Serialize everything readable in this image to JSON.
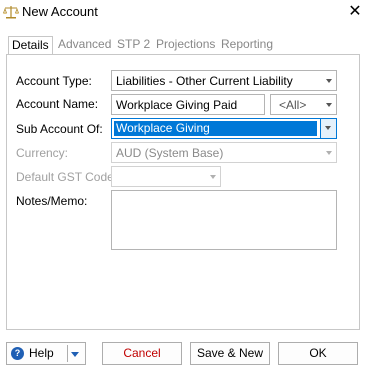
{
  "window": {
    "title": "New Account",
    "close_glyph": "✕",
    "icon": "scales-icon"
  },
  "tabs": [
    {
      "label": "Details",
      "active": true
    },
    {
      "label": "Advanced",
      "active": false
    },
    {
      "label": "STP 2",
      "active": false
    },
    {
      "label": "Projections",
      "active": false
    },
    {
      "label": "Reporting",
      "active": false
    }
  ],
  "form": {
    "account_type": {
      "label": "Account Type:",
      "value": "Liabilities - Other Current Liability"
    },
    "account_name": {
      "label": "Account Name:",
      "value": "Workplace Giving Paid",
      "filter_value": "<All>"
    },
    "sub_account_of": {
      "label": "Sub Account Of:",
      "value": "Workplace Giving"
    },
    "currency": {
      "label": "Currency:",
      "value": "AUD (System Base)"
    },
    "default_gst_code": {
      "label": "Default GST Code:",
      "value": ""
    },
    "notes": {
      "label": "Notes/Memo:",
      "value": ""
    }
  },
  "buttons": {
    "help": "Help",
    "cancel": "Cancel",
    "save_new": "Save & New",
    "ok": "OK"
  },
  "colors": {
    "accent": "#0078d7",
    "cancel_text": "#c00000",
    "help_icon": "#1f5fb4"
  }
}
